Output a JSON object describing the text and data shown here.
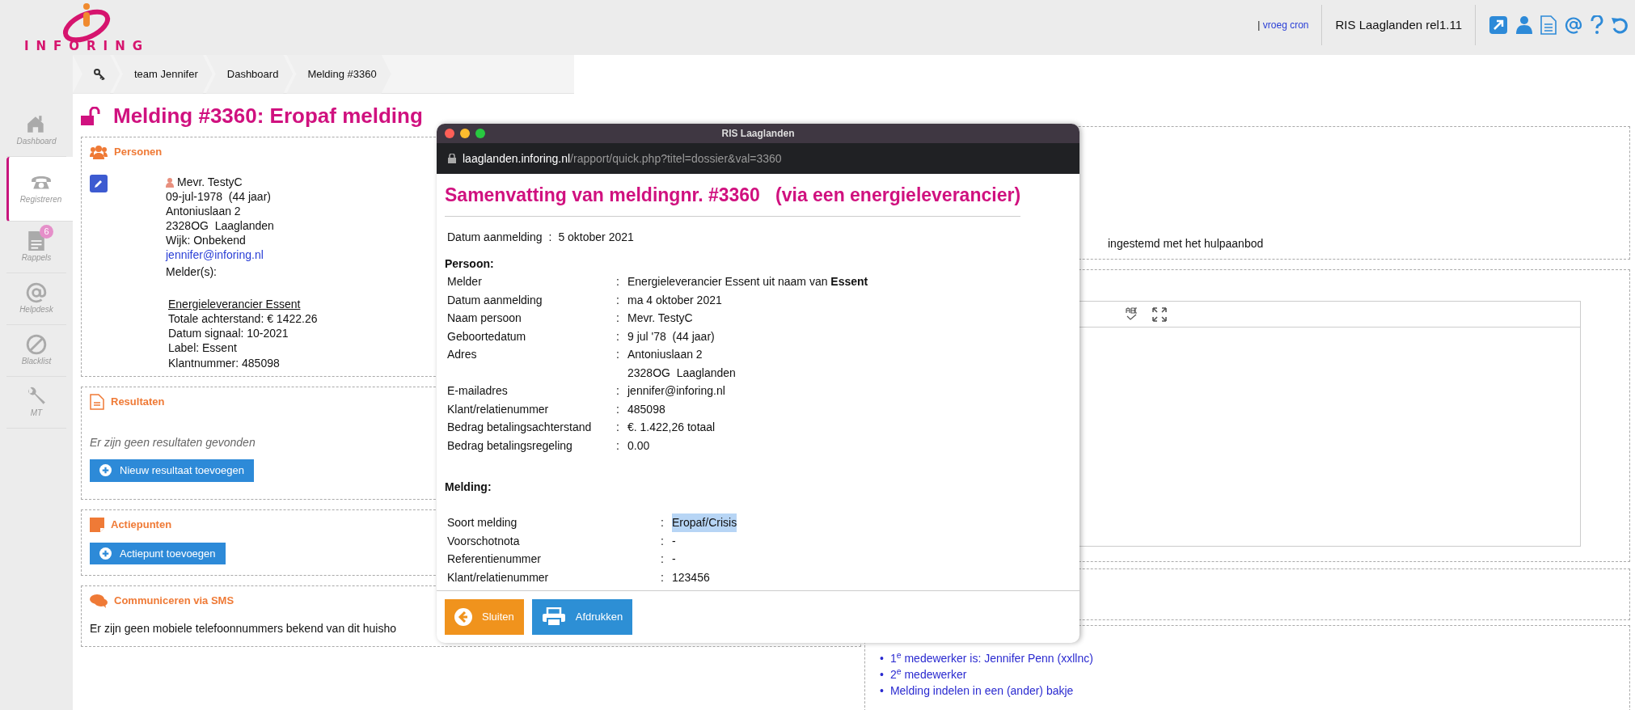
{
  "header": {
    "logo": "INFORING",
    "cron_separator": "|",
    "cron_link": "vroeg cron",
    "version": "RIS Laaglanden rel1.11"
  },
  "breadcrumb": [
    "team Jennifer",
    "Dashboard",
    "Melding #3360"
  ],
  "sidebar": [
    {
      "label": "Dashboard",
      "selected": false
    },
    {
      "label": "Registreren",
      "selected": true
    },
    {
      "label": "Rappels",
      "selected": false,
      "badge": "6"
    },
    {
      "label": "Helpdesk",
      "selected": false
    },
    {
      "label": "Blacklist",
      "selected": false
    },
    {
      "label": "MT",
      "selected": false
    }
  ],
  "page_title": "Melding #3360: Eropaf melding",
  "personen": {
    "title": "Personen",
    "name": "Mevr. TestyC",
    "lines": [
      "09-jul-1978  (44 jaar)",
      "Antoniuslaan 2",
      "2328OG  Laaglanden",
      "Wijk: Onbekend"
    ],
    "email": "jennifer@inforing.nl",
    "melders_label": "Melder(s):",
    "melder": {
      "name": "Energieleverancier Essent",
      "lines": [
        "Totale achterstand: € 1422.26",
        "Datum signaal: 10-2021",
        "Label: Essent",
        "Klantnummer: 485098"
      ]
    }
  },
  "resultaten": {
    "title": "Resultaten",
    "empty_text": "Er zijn geen resultaten gevonden",
    "button": "Nieuw resultaat toevoegen"
  },
  "actiepunten": {
    "title": "Actiepunten",
    "button": "Actiepunt toevoegen"
  },
  "sms": {
    "title": "Communiceren via SMS",
    "text": "Er zijn geen mobiele telefoonnummers bekend van dit huisho"
  },
  "right": {
    "status_text": "ingestemd met het hulpaanbod",
    "list": [
      {
        "bullet": "•",
        "text": "1$^{e}$ medewerker is: Jennifer Penn (xxllnc)"
      },
      {
        "bullet": "•",
        "text": "2$^{e}$ medewerker"
      },
      {
        "bullet": "•",
        "text": "Melding indelen in een (ander) bakje"
      }
    ]
  },
  "modal": {
    "window_title": "RIS Laaglanden",
    "url_host": "laaglanden.inforing.nl",
    "url_path": "/rapport/quick.php?titel=dossier&val=3360",
    "heading": "Samenvatting van meldingnr. #3360   (via een energieleverancier)",
    "date_label": "Datum aanmelding",
    "date_sep": ":",
    "date_value": "5 oktober 2021",
    "person_section": "Persoon:",
    "person_rows": [
      {
        "label": "Melder",
        "sep": ":",
        "value_lines": [
          "Energieleverancier Essent uit naam van **Essent**"
        ]
      },
      {
        "label": "Datum aanmelding",
        "sep": ":",
        "value_lines": [
          "ma 4 oktober 2021"
        ]
      },
      {
        "label": "Naam persoon",
        "sep": ":",
        "value_lines": [
          "Mevr. TestyC"
        ]
      },
      {
        "label": "Geboortedatum",
        "sep": ":",
        "value_lines": [
          "9 jul '78  (44 jaar)"
        ]
      },
      {
        "label": "Adres",
        "sep": ":",
        "value_lines": [
          "Antoniuslaan 2",
          "2328OG  Laaglanden"
        ]
      },
      {
        "label": "E-mailadres",
        "sep": ":",
        "value_lines": [
          "jennifer@inforing.nl"
        ]
      },
      {
        "label": "Klant/relatienummer",
        "sep": ":",
        "value_lines": [
          "485098"
        ]
      },
      {
        "label": "Bedrag betalingsachterstand",
        "sep": ":",
        "value_lines": [
          "€. 1.422,26 totaal"
        ]
      },
      {
        "label": "Bedrag betalingsregeling",
        "sep": ":",
        "value_lines": [
          "0.00"
        ]
      }
    ],
    "melding_section": "Melding:",
    "melding_rows": [
      {
        "label": "Soort melding",
        "sep": ":",
        "value": "Eropaf/Crisis",
        "highlighted": true
      },
      {
        "label": "Voorschotnota",
        "sep": ":",
        "value": "-",
        "highlighted": false
      },
      {
        "label": "Referentienummer",
        "sep": ":",
        "value": "-",
        "highlighted": false
      },
      {
        "label": "Klant/relatienummer",
        "sep": ":",
        "value": "123456",
        "highlighted": false
      }
    ],
    "buttons": [
      {
        "label": "Sluiten",
        "kind": "close"
      },
      {
        "label": "Afdrukken",
        "kind": "print"
      }
    ]
  }
}
